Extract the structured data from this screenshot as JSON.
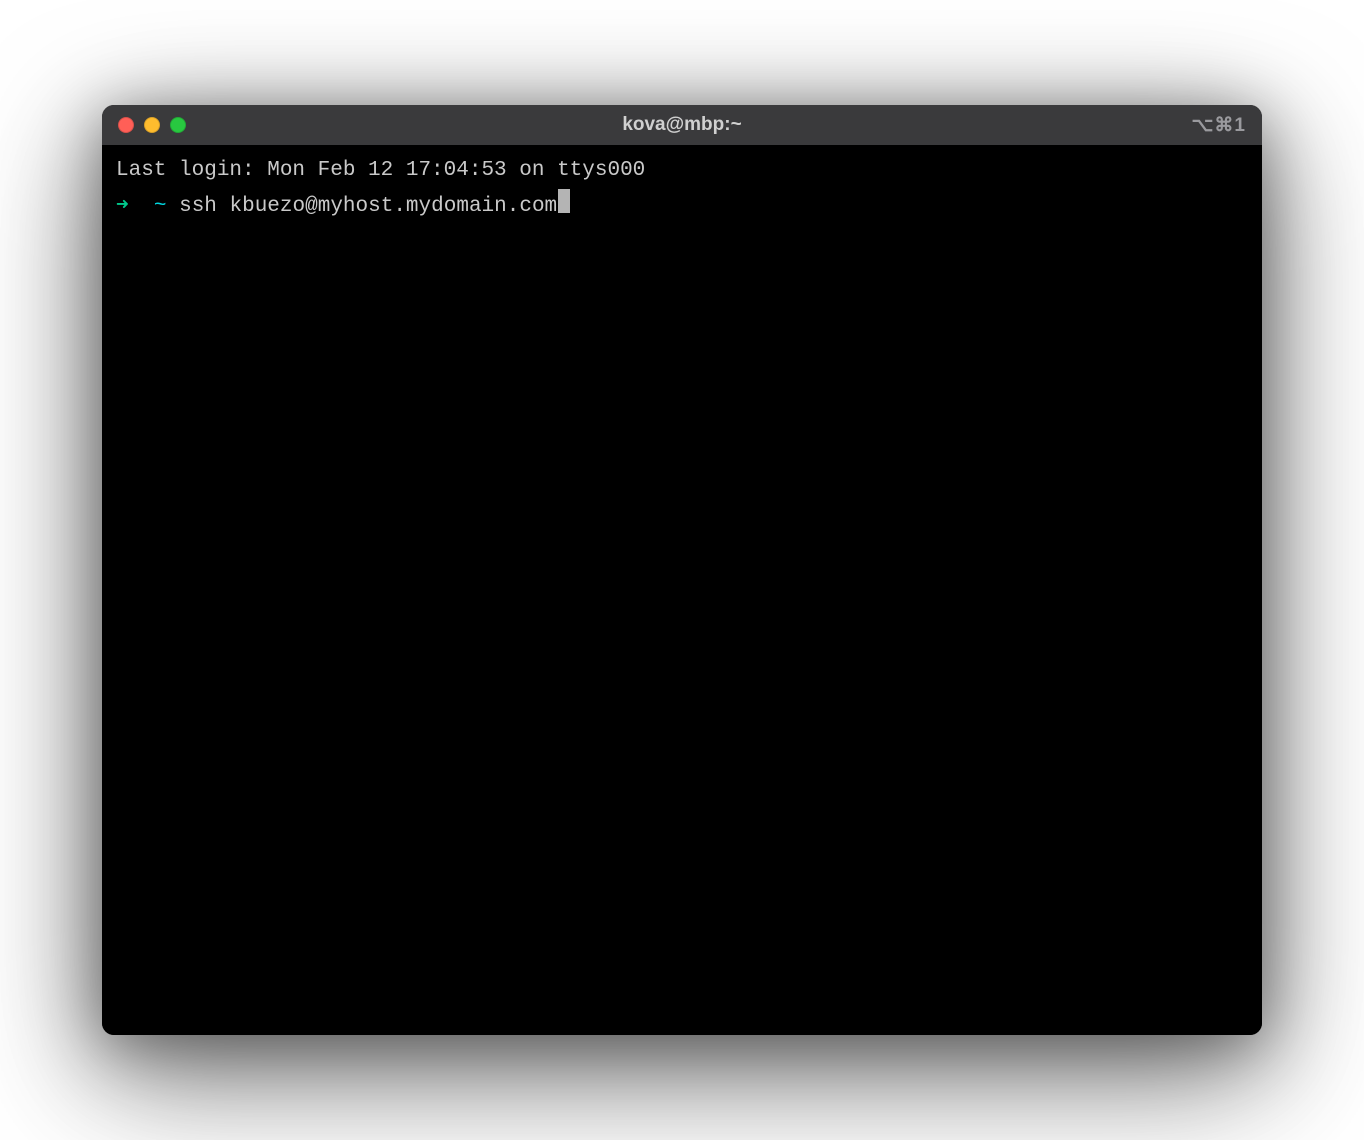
{
  "titlebar": {
    "title": "kova@mbp:~",
    "indicator": "⌥⌘1"
  },
  "terminal": {
    "last_login": "Last login: Mon Feb 12 17:04:53 on ttys000",
    "prompt": {
      "arrow": "➜",
      "spacer1": "  ",
      "tilde": "~",
      "spacer2": " ",
      "command": "ssh kbuezo@myhost.mydomain.com"
    }
  }
}
